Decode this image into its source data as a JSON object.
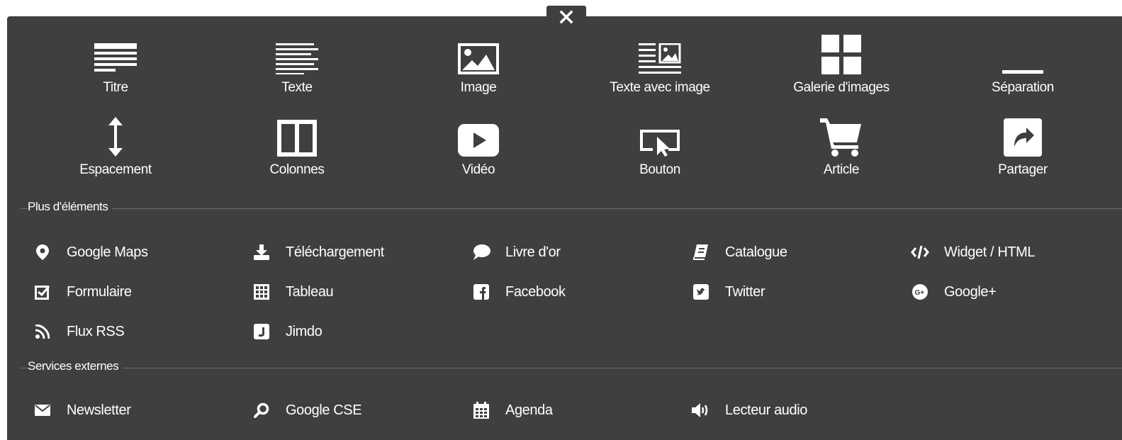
{
  "close": {
    "glyph": "✕"
  },
  "main_elements": [
    {
      "label": "Titre",
      "icon": "title-icon"
    },
    {
      "label": "Texte",
      "icon": "text-icon"
    },
    {
      "label": "Image",
      "icon": "image-icon"
    },
    {
      "label": "Texte avec image",
      "icon": "text-with-image-icon"
    },
    {
      "label": "Galerie d'images",
      "icon": "gallery-icon"
    },
    {
      "label": "Séparation",
      "icon": "separator-icon"
    },
    {
      "label": "Espacement",
      "icon": "spacing-icon"
    },
    {
      "label": "Colonnes",
      "icon": "columns-icon"
    },
    {
      "label": "Vidéo",
      "icon": "video-icon"
    },
    {
      "label": "Bouton",
      "icon": "button-icon"
    },
    {
      "label": "Article",
      "icon": "cart-icon"
    },
    {
      "label": "Partager",
      "icon": "share-icon"
    }
  ],
  "more_elements": {
    "title": "Plus d'éléments",
    "items": [
      {
        "label": "Google Maps",
        "icon": "map-pin-icon"
      },
      {
        "label": "Téléchargement",
        "icon": "download-icon"
      },
      {
        "label": "Livre d'or",
        "icon": "speech-bubble-icon"
      },
      {
        "label": "Catalogue",
        "icon": "book-icon"
      },
      {
        "label": "Widget / HTML",
        "icon": "code-icon"
      },
      {
        "label": "Formulaire",
        "icon": "checkbox-icon"
      },
      {
        "label": "Tableau",
        "icon": "table-icon"
      },
      {
        "label": "Facebook",
        "icon": "facebook-icon"
      },
      {
        "label": "Twitter",
        "icon": "twitter-icon"
      },
      {
        "label": "Google+",
        "icon": "google-plus-icon"
      },
      {
        "label": "Flux RSS",
        "icon": "rss-icon"
      },
      {
        "label": "Jimdo",
        "icon": "jimdo-icon"
      }
    ]
  },
  "external_services": {
    "title": "Services externes",
    "items": [
      {
        "label": "Newsletter",
        "icon": "envelope-icon"
      },
      {
        "label": "Google CSE",
        "icon": "search-icon"
      },
      {
        "label": "Agenda",
        "icon": "calendar-icon"
      },
      {
        "label": "Lecteur audio",
        "icon": "speaker-icon"
      }
    ]
  },
  "colors": {
    "panel": "#3f3f3f",
    "text": "#ffffff",
    "rule": "#6a6a6a"
  }
}
